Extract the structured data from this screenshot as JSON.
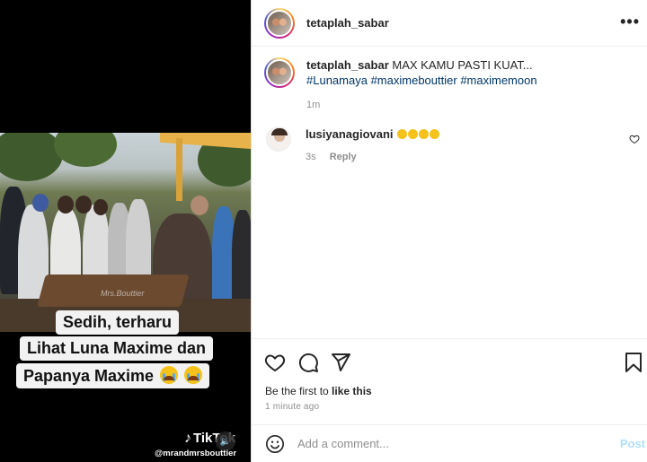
{
  "video": {
    "scene_watermark": "Mrs.Bouttier",
    "overlay_lines": [
      "Sedih, terharu",
      "Lihat Luna Maxime dan",
      "Papanya Maxime"
    ],
    "tiktok_brand": "TikTok",
    "tiktok_handle": "@mrandmrsbouttier"
  },
  "header": {
    "username": "tetaplah_sabar"
  },
  "caption": {
    "username": "tetaplah_sabar",
    "text": "MAX KAMU PASTI KUAT...",
    "hashtags": [
      "#Lunamaya",
      "#maximebouttier",
      "#maximemoon"
    ],
    "age": "1m"
  },
  "comments": [
    {
      "username": "lusiyanagiovani",
      "age": "3s",
      "reply_label": "Reply"
    }
  ],
  "actions": {
    "likes_prefix": "Be the first to ",
    "likes_link": "like this",
    "timestamp": "1 minute ago"
  },
  "add_comment": {
    "placeholder": "Add a comment...",
    "post_label": "Post"
  },
  "icons": {
    "more": "more-horizontal-icon",
    "like": "heart-icon",
    "comment": "comment-icon",
    "share": "send-icon",
    "save": "bookmark-icon",
    "emoji": "emoji-icon"
  },
  "colors": {
    "link": "#00376b",
    "muted": "#8e8e8e",
    "post_disabled": "#b2dffc"
  }
}
